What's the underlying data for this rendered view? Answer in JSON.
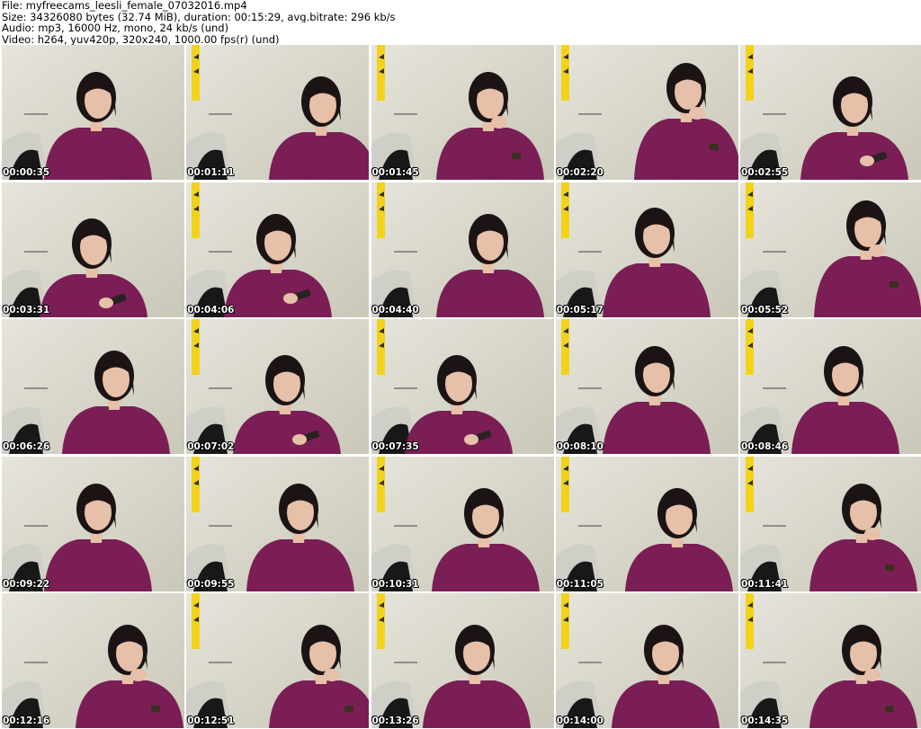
{
  "header": {
    "file_line": "File: myfreecams_leesli_female_07032016.mp4",
    "size_line": "Size: 34326080 bytes (32.74 MiB), duration: 00:15:29, avg.bitrate: 296 kb/s",
    "audio_line": "Audio: mp3, 16000 Hz, mono, 24 kb/s (und)",
    "video_line": "Video: h264, yuv420p, 320x240, 1000.00 fps(r) (und)"
  },
  "thumbnails": [
    {
      "timestamp": "00:00:35"
    },
    {
      "timestamp": "00:01:11"
    },
    {
      "timestamp": "00:01:45"
    },
    {
      "timestamp": "00:02:20"
    },
    {
      "timestamp": "00:02:55"
    },
    {
      "timestamp": "00:03:31"
    },
    {
      "timestamp": "00:04:06"
    },
    {
      "timestamp": "00:04:40"
    },
    {
      "timestamp": "00:05:17"
    },
    {
      "timestamp": "00:05:52"
    },
    {
      "timestamp": "00:06:26"
    },
    {
      "timestamp": "00:07:02"
    },
    {
      "timestamp": "00:07:35"
    },
    {
      "timestamp": "00:08:10"
    },
    {
      "timestamp": "00:08:46"
    },
    {
      "timestamp": "00:09:22"
    },
    {
      "timestamp": "00:09:55"
    },
    {
      "timestamp": "00:10:31"
    },
    {
      "timestamp": "00:11:05"
    },
    {
      "timestamp": "00:11:41"
    },
    {
      "timestamp": "00:12:16"
    },
    {
      "timestamp": "00:12:51"
    },
    {
      "timestamp": "00:13:26"
    },
    {
      "timestamp": "00:14:00"
    },
    {
      "timestamp": "00:14:35"
    }
  ],
  "colors": {
    "wall": "#dedcd0",
    "shirt": "#7a1e55",
    "hair": "#1c1414",
    "skin": "#e6c0a8",
    "chair": "#181818",
    "accent_yellow": "#f2d31a"
  }
}
